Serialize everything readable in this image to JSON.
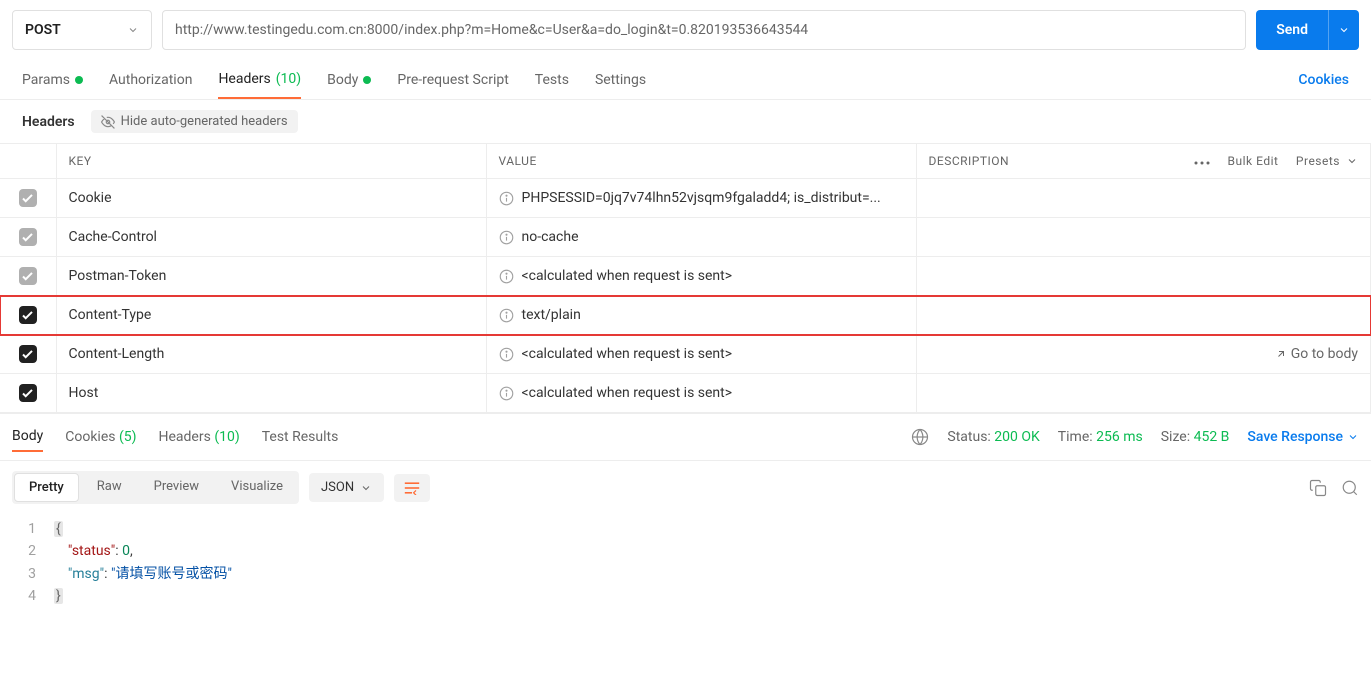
{
  "request": {
    "method": "POST",
    "url": "http://www.testingedu.com.cn:8000/index.php?m=Home&c=User&a=do_login&t=0.820193536643544",
    "send_label": "Send"
  },
  "tabs": {
    "params": "Params",
    "auth": "Authorization",
    "headers": "Headers",
    "headers_count": "(10)",
    "body": "Body",
    "prereq": "Pre-request Script",
    "tests": "Tests",
    "settings": "Settings",
    "cookies": "Cookies"
  },
  "headers_section": {
    "title": "Headers",
    "hide_label": "Hide auto-generated headers",
    "key_header": "KEY",
    "value_header": "VALUE",
    "desc_header": "DESCRIPTION",
    "bulk_edit": "Bulk Edit",
    "presets": "Presets",
    "go_to_body": "Go to body",
    "rows": [
      {
        "key": "Cookie",
        "value": "PHPSESSID=0jq7v74lhn52vjsqm9fgaladd4; is_distribut=...",
        "grey": true,
        "highlight": false
      },
      {
        "key": "Cache-Control",
        "value": "no-cache",
        "grey": true,
        "highlight": false
      },
      {
        "key": "Postman-Token",
        "value": "<calculated when request is sent>",
        "grey": true,
        "highlight": false
      },
      {
        "key": "Content-Type",
        "value": "text/plain",
        "grey": false,
        "highlight": true
      },
      {
        "key": "Content-Length",
        "value": "<calculated when request is sent>",
        "grey": false,
        "highlight": false,
        "go_to_body": true
      },
      {
        "key": "Host",
        "value": "<calculated when request is sent>",
        "grey": false,
        "highlight": false
      }
    ]
  },
  "response": {
    "tabs": {
      "body": "Body",
      "cookies": "Cookies",
      "cookies_count": "(5)",
      "headers": "Headers",
      "headers_count": "(10)",
      "tests": "Test Results"
    },
    "status_label": "Status:",
    "status_value": "200 OK",
    "time_label": "Time:",
    "time_value": "256 ms",
    "size_label": "Size:",
    "size_value": "452 B",
    "save_label": "Save Response"
  },
  "view": {
    "pretty": "Pretty",
    "raw": "Raw",
    "preview": "Preview",
    "visualize": "Visualize",
    "lang": "JSON"
  },
  "json_body": {
    "status": 0,
    "msg": "请填写账号或密码"
  }
}
